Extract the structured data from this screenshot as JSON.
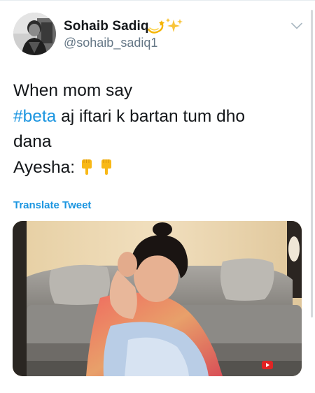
{
  "tweet": {
    "display_name": "Sohaib Sadiq",
    "handle": "@sohaib_sadiq1",
    "name_emoji": [
      "dizzy-emoji",
      "sparkles-emoji"
    ],
    "text_lines": {
      "line1": "When mom say",
      "hashtag": "#beta",
      "line2_rest": " aj iftari k bartan  tum dho",
      "line3": "dana",
      "line4": "Ayesha:"
    },
    "trailing_emoji": [
      "point-down-emoji",
      "point-down-emoji"
    ],
    "translate_label": "Translate Tweet",
    "media": {
      "kind": "video-still",
      "description_icon": "image-thumbnail",
      "watermark_icon": "youtube-play-icon"
    }
  },
  "colors": {
    "link": "#1b95e0",
    "text": "#14171a",
    "secondary": "#657786",
    "divider": "#e6ecf0"
  }
}
